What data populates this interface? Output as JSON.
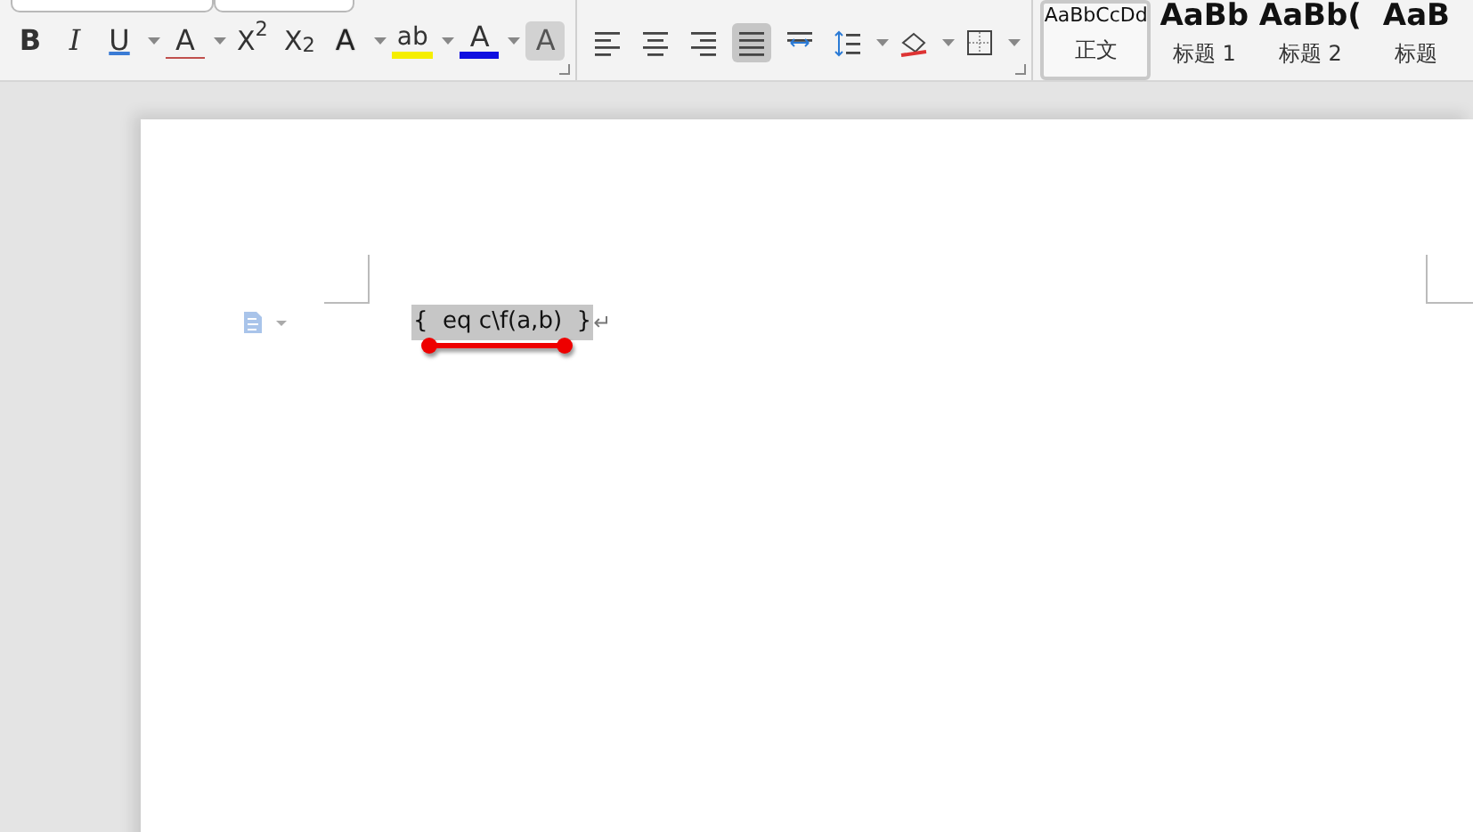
{
  "font_group": {
    "buttons": [
      {
        "kind": "bold",
        "label": "B",
        "dropdown": false
      },
      {
        "kind": "italic",
        "label": "I",
        "dropdown": false
      },
      {
        "kind": "underline",
        "label": "U",
        "dropdown": true
      },
      {
        "kind": "strike",
        "label": "A",
        "dropdown": true
      },
      {
        "kind": "superscript",
        "label": "X$^{2}$",
        "dropdown": false
      },
      {
        "kind": "subscript",
        "label": "X$_{2}$",
        "dropdown": false
      },
      {
        "kind": "effect",
        "label": "A",
        "dropdown": true
      },
      {
        "kind": "highlight",
        "label": "ab",
        "dropdown": true
      },
      {
        "kind": "color",
        "label": "A",
        "dropdown": true
      },
      {
        "kind": "shade",
        "label": "A",
        "dropdown": false
      }
    ]
  },
  "paragraph_group": {
    "buttons": [
      {
        "kind": "align-left",
        "selected": false,
        "dropdown": false
      },
      {
        "kind": "align-center",
        "selected": false,
        "dropdown": false
      },
      {
        "kind": "align-right",
        "selected": false,
        "dropdown": false
      },
      {
        "kind": "justify",
        "selected": true,
        "dropdown": false
      },
      {
        "kind": "distribute",
        "selected": false,
        "dropdown": false
      },
      {
        "kind": "line-spacing",
        "selected": false,
        "dropdown": true
      },
      {
        "kind": "shading",
        "selected": false,
        "dropdown": true
      },
      {
        "kind": "borders",
        "selected": false,
        "dropdown": true
      }
    ]
  },
  "styles": [
    {
      "preview": "AaBbCcDd",
      "label": "正文",
      "selected": true,
      "kind": "body"
    },
    {
      "preview": "AaBb",
      "label": "标题 1",
      "selected": false,
      "kind": "heading"
    },
    {
      "preview": "AaBb(",
      "label": "标题 2",
      "selected": false,
      "kind": "heading"
    },
    {
      "preview": "AaB",
      "label": "标题",
      "selected": false,
      "kind": "heading"
    }
  ],
  "document": {
    "field_code": "{  eq c\\f(a,b)  }",
    "field_shaded": true,
    "paragraph_mark": "↵",
    "annotation": {
      "kind": "underline"
    }
  }
}
